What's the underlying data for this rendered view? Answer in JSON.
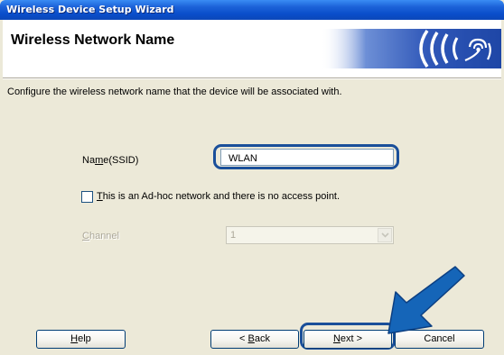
{
  "window": {
    "title": "Wireless Device Setup Wizard"
  },
  "header": {
    "heading": "Wireless Network Name",
    "logo_icon": "wireless-signal-icon"
  },
  "description": "Configure the wireless network name that the device will be associated with.",
  "form": {
    "ssid_label": "Name(SSID)",
    "ssid_value": "WLAN",
    "adhoc_label": "This is an Ad-hoc network and there is no access point.",
    "adhoc_checked": false,
    "channel_label": "Channel",
    "channel_value": "1"
  },
  "buttons": {
    "help": "Help",
    "back": "< Back",
    "next": "Next >",
    "cancel": "Cancel"
  },
  "colors": {
    "titlebar": "#0a4ecb",
    "header_band": "#2f57b8",
    "highlight_ring": "#1a4f9a",
    "pointer_arrow": "#1565b8",
    "dialog_bg": "#ece9d8"
  },
  "annotations": {
    "pointer_icon": "arrow-pointer-icon"
  }
}
